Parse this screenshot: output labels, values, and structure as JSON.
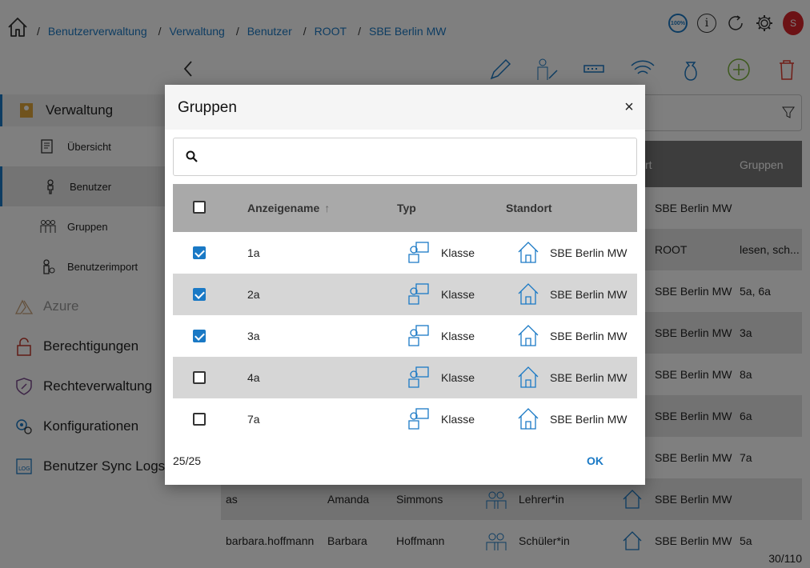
{
  "breadcrumb": [
    "Benutzerverwaltung",
    "Verwaltung",
    "Benutzer",
    "ROOT",
    "SBE Berlin MW"
  ],
  "breadcrumb_separator": "/",
  "topbar": {
    "zoom_label": "100%",
    "info_label": "i",
    "avatar_initial": "S"
  },
  "sidebar": {
    "items": [
      {
        "label": "Verwaltung",
        "icon": "admin-icon"
      },
      {
        "label": "Übersicht",
        "icon": "overview-icon"
      },
      {
        "label": "Benutzer",
        "icon": "user-icon"
      },
      {
        "label": "Gruppen",
        "icon": "groups-icon"
      },
      {
        "label": "Benutzerimport",
        "icon": "user-import-icon"
      },
      {
        "label": "Azure",
        "icon": "azure-icon"
      },
      {
        "label": "Berechtigungen",
        "icon": "lock-icon"
      },
      {
        "label": "Rechteverwaltung",
        "icon": "key-shield-icon"
      },
      {
        "label": "Konfigurationen",
        "icon": "gears-icon"
      },
      {
        "label": "Benutzer Sync Logs",
        "icon": "log-icon"
      }
    ]
  },
  "background_table": {
    "header_partial": "rt",
    "header_groups": "Gruppen",
    "rows": [
      {
        "login": "",
        "first": "",
        "last": "",
        "role": "",
        "location": "SBE Berlin MW",
        "groups": ""
      },
      {
        "login": "",
        "first": "",
        "last": "",
        "role": "",
        "location": "ROOT",
        "groups": "lesen, sch..."
      },
      {
        "login": "",
        "first": "",
        "last": "",
        "role": "",
        "location": "SBE Berlin MW",
        "groups": "5a, 6a"
      },
      {
        "login": "",
        "first": "",
        "last": "",
        "role": "",
        "location": "SBE Berlin MW",
        "groups": "3a"
      },
      {
        "login": "",
        "first": "",
        "last": "",
        "role": "",
        "location": "SBE Berlin MW",
        "groups": "8a"
      },
      {
        "login": "",
        "first": "",
        "last": "",
        "role": "",
        "location": "SBE Berlin MW",
        "groups": "6a"
      },
      {
        "login": "",
        "first": "",
        "last": "",
        "role": "",
        "location": "SBE Berlin MW",
        "groups": "7a"
      },
      {
        "login": "as",
        "first": "Amanda",
        "last": "Simmons",
        "role": "Lehrer*in",
        "location": "SBE Berlin MW",
        "groups": ""
      },
      {
        "login": "barbara.hoffmann",
        "first": "Barbara",
        "last": "Hoffmann",
        "role": "Schüler*in",
        "location": "SBE Berlin MW",
        "groups": "5a"
      }
    ],
    "pager": "30/110"
  },
  "modal": {
    "title": "Gruppen",
    "close_label": "×",
    "search_placeholder": "",
    "columns": {
      "name": "Anzeigename",
      "type": "Typ",
      "location": "Standort"
    },
    "rows": [
      {
        "checked": true,
        "name": "1a",
        "type": "Klasse",
        "location": "SBE Berlin MW"
      },
      {
        "checked": true,
        "name": "2a",
        "type": "Klasse",
        "location": "SBE Berlin MW"
      },
      {
        "checked": true,
        "name": "3a",
        "type": "Klasse",
        "location": "SBE Berlin MW"
      },
      {
        "checked": false,
        "name": "4a",
        "type": "Klasse",
        "location": "SBE Berlin MW"
      },
      {
        "checked": false,
        "name": "7a",
        "type": "Klasse",
        "location": "SBE Berlin MW"
      }
    ],
    "count": "25/25",
    "ok_label": "OK"
  },
  "colors": {
    "accent": "#1a79c5",
    "avatar": "#d9252b",
    "header_gray": "#a9a9a9",
    "alt_row": "#d6d6d6"
  }
}
